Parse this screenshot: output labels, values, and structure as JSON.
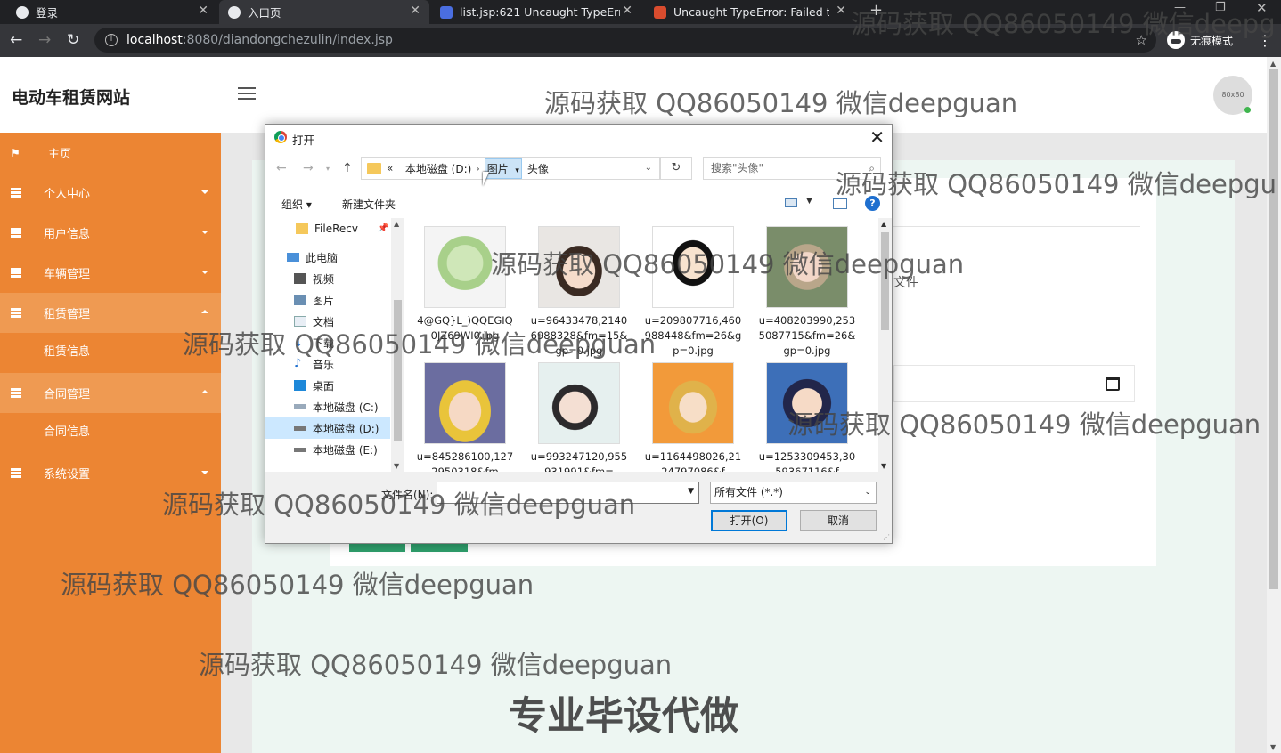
{
  "browser": {
    "tabs": [
      {
        "title": "登录"
      },
      {
        "title": "入口页"
      },
      {
        "title": "list.jsp:621 Uncaught TypeError"
      },
      {
        "title": "Uncaught TypeError: Failed to"
      }
    ],
    "url_host": "localhost",
    "url_path": ":8080/diandongchezulin/index.jsp",
    "incognito_label": "无痕模式"
  },
  "app": {
    "brand": "电动车租赁网站",
    "avatar_text": "80x80",
    "menu": [
      {
        "label": "主页"
      },
      {
        "label": "个人中心"
      },
      {
        "label": "用户信息"
      },
      {
        "label": "车辆管理"
      },
      {
        "label": "租赁管理"
      },
      {
        "label": "租赁信息"
      },
      {
        "label": "合同管理"
      },
      {
        "label": "合同信息"
      },
      {
        "label": "系统设置"
      }
    ],
    "form_label_partial": "文件"
  },
  "dialog": {
    "title": "打开",
    "breadcrumb": {
      "chevrons": "«",
      "drive": "本地磁盘 (D:)",
      "folder": "图片",
      "current": "头像"
    },
    "search_placeholder": "搜索\"头像\"",
    "organize": "组织 ▾",
    "new_folder": "新建文件夹",
    "tree": [
      {
        "label": "FileRecv"
      },
      {
        "label": "此电脑"
      },
      {
        "label": "视频"
      },
      {
        "label": "图片"
      },
      {
        "label": "文档"
      },
      {
        "label": "下载"
      },
      {
        "label": "音乐"
      },
      {
        "label": "桌面"
      },
      {
        "label": "本地磁盘 (C:)"
      },
      {
        "label": "本地磁盘 (D:)"
      },
      {
        "label": "本地磁盘 (E:)"
      }
    ],
    "files": [
      {
        "name": "4@GQ}L_)QQEGIQ0JZ69WI0.jpg"
      },
      {
        "name": "u=96433478,21406988328&fm=15&gp=0.jpg"
      },
      {
        "name": "u=209807716,460988448&fm=26&gp=0.jpg"
      },
      {
        "name": "u=408203990,2535087715&fm=26&gp=0.jpg"
      },
      {
        "name": "u=845286100,1272950318&fm"
      },
      {
        "name": "u=993247120,955931991&fm="
      },
      {
        "name": "u=1164498026,2124797086&f"
      },
      {
        "name": "u=1253309453,3059367116&f"
      }
    ],
    "filename_label": "文件名(N):",
    "filename_value": "",
    "filetype": "所有文件 (*.*)",
    "open_button": "打开(O)",
    "cancel_button": "取消"
  },
  "watermarks": {
    "qq": "源码获取 QQ86050149 微信deepguan",
    "qq_cut": "源码获取 QQ86050149 微信deepg",
    "qq_cut2": "源码获取 QQ86050149 微信deepgu",
    "promo": "专业毕设代做"
  },
  "colors": {
    "sidebar": "#ec8533",
    "accent": "#2e9e6b",
    "selection": "#cce8ff"
  }
}
